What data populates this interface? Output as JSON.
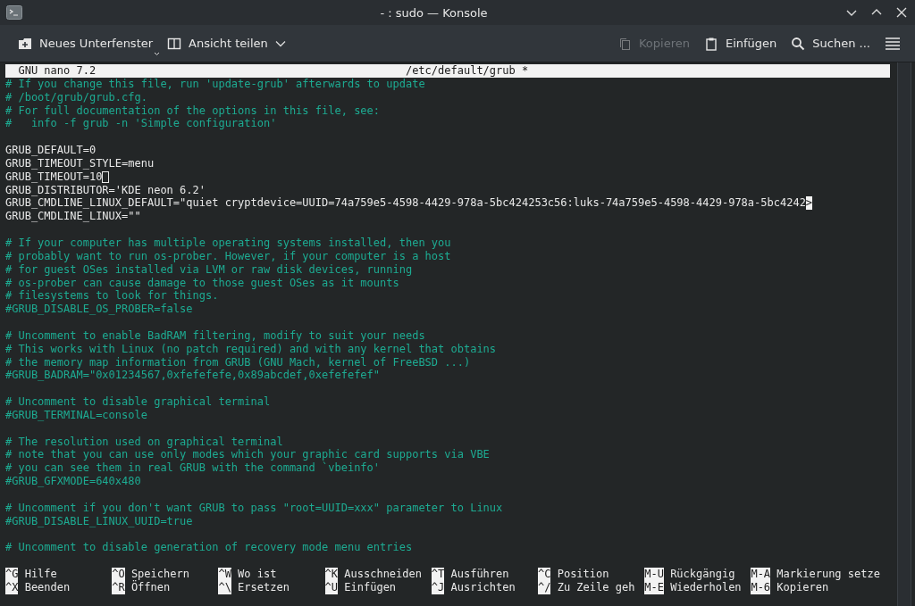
{
  "window": {
    "title": "- : sudo — Konsole"
  },
  "toolbar": {
    "left": [
      {
        "label": "Neues Unterfenster",
        "kind": "new-tab",
        "disabled": false
      },
      {
        "label": "Ansicht teilen",
        "kind": "split",
        "disabled": false
      }
    ],
    "right": [
      {
        "label": "Kopieren",
        "kind": "copy",
        "disabled": true
      },
      {
        "label": "Einfügen",
        "kind": "paste",
        "disabled": false
      },
      {
        "label": "Suchen ...",
        "kind": "search",
        "disabled": false
      }
    ]
  },
  "nano": {
    "app": "GNU nano 7.2",
    "file": "/etc/default/grub *",
    "lines": [
      {
        "kind": "comment",
        "text": "# If you change this file, run 'update-grub' afterwards to update"
      },
      {
        "kind": "comment",
        "text": "# /boot/grub/grub.cfg."
      },
      {
        "kind": "comment",
        "text": "# For full documentation of the options in this file, see:"
      },
      {
        "kind": "comment",
        "text": "#   info -f grub -n 'Simple configuration'"
      },
      {
        "kind": "blank"
      },
      {
        "kind": "code",
        "text": "GRUB_DEFAULT=0"
      },
      {
        "kind": "code",
        "text": "GRUB_TIMEOUT_STYLE=menu"
      },
      {
        "kind": "code",
        "text": "GRUB_TIMEOUT=10",
        "cursor": true
      },
      {
        "kind": "code",
        "text": "GRUB_DISTRIBUTOR='KDE neon 6.2'"
      },
      {
        "kind": "code",
        "text": "GRUB_CMDLINE_LINUX_DEFAULT=\"quiet cryptdevice=UUID=74a759e5-4598-4429-978a-5bc424253c56:luks-74a759e5-4598-4429-978a-5bc4242",
        "overflow_mark": ">"
      },
      {
        "kind": "code",
        "text": "GRUB_CMDLINE_LINUX=\"\""
      },
      {
        "kind": "blank"
      },
      {
        "kind": "comment",
        "text": "# If your computer has multiple operating systems installed, then you"
      },
      {
        "kind": "comment",
        "text": "# probably want to run os-prober. However, if your computer is a host"
      },
      {
        "kind": "comment",
        "text": "# for guest OSes installed via LVM or raw disk devices, running"
      },
      {
        "kind": "comment",
        "text": "# os-prober can cause damage to those guest OSes as it mounts"
      },
      {
        "kind": "comment",
        "text": "# filesystems to look for things."
      },
      {
        "kind": "comment",
        "text": "#GRUB_DISABLE_OS_PROBER=false"
      },
      {
        "kind": "blank"
      },
      {
        "kind": "comment",
        "text": "# Uncomment to enable BadRAM filtering, modify to suit your needs"
      },
      {
        "kind": "comment",
        "text": "# This works with Linux (no patch required) and with any kernel that obtains"
      },
      {
        "kind": "comment",
        "text": "# the memory map information from GRUB (GNU Mach, kernel of FreeBSD ...)"
      },
      {
        "kind": "comment",
        "text": "#GRUB_BADRAM=\"0x01234567,0xfefefefe,0x89abcdef,0xefefefef\""
      },
      {
        "kind": "blank"
      },
      {
        "kind": "comment",
        "text": "# Uncomment to disable graphical terminal"
      },
      {
        "kind": "comment",
        "text": "#GRUB_TERMINAL=console"
      },
      {
        "kind": "blank"
      },
      {
        "kind": "comment",
        "text": "# The resolution used on graphical terminal"
      },
      {
        "kind": "comment",
        "text": "# note that you can use only modes which your graphic card supports via VBE"
      },
      {
        "kind": "comment",
        "text": "# you can see them in real GRUB with the command `vbeinfo'"
      },
      {
        "kind": "comment",
        "text": "#GRUB_GFXMODE=640x480"
      },
      {
        "kind": "blank"
      },
      {
        "kind": "comment",
        "text": "# Uncomment if you don't want GRUB to pass \"root=UUID=xxx\" parameter to Linux"
      },
      {
        "kind": "comment",
        "text": "#GRUB_DISABLE_LINUX_UUID=true"
      },
      {
        "kind": "blank"
      },
      {
        "kind": "comment",
        "text": "# Uncomment to disable generation of recovery mode menu entries"
      }
    ],
    "shortcuts": [
      [
        {
          "key": "^G",
          "label": "Hilfe"
        },
        {
          "key": "^O",
          "label": "Speichern"
        },
        {
          "key": "^W",
          "label": "Wo ist"
        },
        {
          "key": "^K",
          "label": "Ausschneiden"
        },
        {
          "key": "^T",
          "label": "Ausführen"
        },
        {
          "key": "^C",
          "label": "Position"
        },
        {
          "key": "M-U",
          "label": "Rückgängig"
        },
        {
          "key": "M-A",
          "label": "Markierung setze"
        }
      ],
      [
        {
          "key": "^X",
          "label": "Beenden"
        },
        {
          "key": "^R",
          "label": "Öffnen"
        },
        {
          "key": "^\\",
          "label": "Ersetzen"
        },
        {
          "key": "^U",
          "label": "Einfügen"
        },
        {
          "key": "^J",
          "label": "Ausrichten"
        },
        {
          "key": "^/",
          "label": "Zu Zeile geh"
        },
        {
          "key": "M-E",
          "label": "Wiederholen"
        },
        {
          "key": "M-6",
          "label": "Kopieren"
        }
      ]
    ]
  }
}
